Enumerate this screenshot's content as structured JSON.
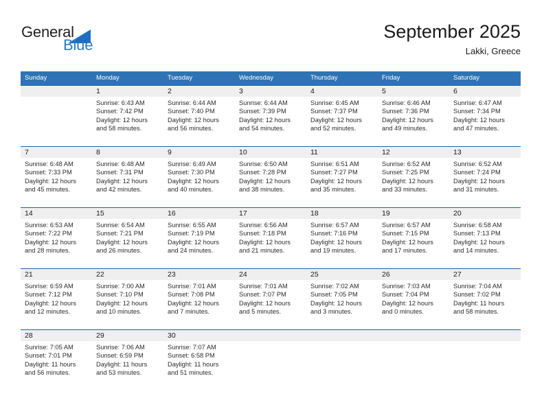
{
  "logo": {
    "general_text": "General",
    "blue_text": "Blue",
    "triangle_icon": "triangle-icon",
    "accent_color": "#2b7cc4"
  },
  "header": {
    "title": "September 2025",
    "subtitle": "Lakki, Greece"
  },
  "theme": {
    "header_blue": "#2e74b5",
    "row_rule_blue": "#1f5fa8",
    "day_band_gray": "#efefef"
  },
  "weekdays": [
    "Sunday",
    "Monday",
    "Tuesday",
    "Wednesday",
    "Thursday",
    "Friday",
    "Saturday"
  ],
  "weeks": [
    [
      {
        "day": "",
        "sunrise": "",
        "sunset": "",
        "daylight1": "",
        "daylight2": ""
      },
      {
        "day": "1",
        "sunrise": "Sunrise: 6:43 AM",
        "sunset": "Sunset: 7:42 PM",
        "daylight1": "Daylight: 12 hours",
        "daylight2": "and 58 minutes."
      },
      {
        "day": "2",
        "sunrise": "Sunrise: 6:44 AM",
        "sunset": "Sunset: 7:40 PM",
        "daylight1": "Daylight: 12 hours",
        "daylight2": "and 56 minutes."
      },
      {
        "day": "3",
        "sunrise": "Sunrise: 6:44 AM",
        "sunset": "Sunset: 7:39 PM",
        "daylight1": "Daylight: 12 hours",
        "daylight2": "and 54 minutes."
      },
      {
        "day": "4",
        "sunrise": "Sunrise: 6:45 AM",
        "sunset": "Sunset: 7:37 PM",
        "daylight1": "Daylight: 12 hours",
        "daylight2": "and 52 minutes."
      },
      {
        "day": "5",
        "sunrise": "Sunrise: 6:46 AM",
        "sunset": "Sunset: 7:36 PM",
        "daylight1": "Daylight: 12 hours",
        "daylight2": "and 49 minutes."
      },
      {
        "day": "6",
        "sunrise": "Sunrise: 6:47 AM",
        "sunset": "Sunset: 7:34 PM",
        "daylight1": "Daylight: 12 hours",
        "daylight2": "and 47 minutes."
      }
    ],
    [
      {
        "day": "7",
        "sunrise": "Sunrise: 6:48 AM",
        "sunset": "Sunset: 7:33 PM",
        "daylight1": "Daylight: 12 hours",
        "daylight2": "and 45 minutes."
      },
      {
        "day": "8",
        "sunrise": "Sunrise: 6:48 AM",
        "sunset": "Sunset: 7:31 PM",
        "daylight1": "Daylight: 12 hours",
        "daylight2": "and 42 minutes."
      },
      {
        "day": "9",
        "sunrise": "Sunrise: 6:49 AM",
        "sunset": "Sunset: 7:30 PM",
        "daylight1": "Daylight: 12 hours",
        "daylight2": "and 40 minutes."
      },
      {
        "day": "10",
        "sunrise": "Sunrise: 6:50 AM",
        "sunset": "Sunset: 7:28 PM",
        "daylight1": "Daylight: 12 hours",
        "daylight2": "and 38 minutes."
      },
      {
        "day": "11",
        "sunrise": "Sunrise: 6:51 AM",
        "sunset": "Sunset: 7:27 PM",
        "daylight1": "Daylight: 12 hours",
        "daylight2": "and 35 minutes."
      },
      {
        "day": "12",
        "sunrise": "Sunrise: 6:52 AM",
        "sunset": "Sunset: 7:25 PM",
        "daylight1": "Daylight: 12 hours",
        "daylight2": "and 33 minutes."
      },
      {
        "day": "13",
        "sunrise": "Sunrise: 6:52 AM",
        "sunset": "Sunset: 7:24 PM",
        "daylight1": "Daylight: 12 hours",
        "daylight2": "and 31 minutes."
      }
    ],
    [
      {
        "day": "14",
        "sunrise": "Sunrise: 6:53 AM",
        "sunset": "Sunset: 7:22 PM",
        "daylight1": "Daylight: 12 hours",
        "daylight2": "and 28 minutes."
      },
      {
        "day": "15",
        "sunrise": "Sunrise: 6:54 AM",
        "sunset": "Sunset: 7:21 PM",
        "daylight1": "Daylight: 12 hours",
        "daylight2": "and 26 minutes."
      },
      {
        "day": "16",
        "sunrise": "Sunrise: 6:55 AM",
        "sunset": "Sunset: 7:19 PM",
        "daylight1": "Daylight: 12 hours",
        "daylight2": "and 24 minutes."
      },
      {
        "day": "17",
        "sunrise": "Sunrise: 6:56 AM",
        "sunset": "Sunset: 7:18 PM",
        "daylight1": "Daylight: 12 hours",
        "daylight2": "and 21 minutes."
      },
      {
        "day": "18",
        "sunrise": "Sunrise: 6:57 AM",
        "sunset": "Sunset: 7:16 PM",
        "daylight1": "Daylight: 12 hours",
        "daylight2": "and 19 minutes."
      },
      {
        "day": "19",
        "sunrise": "Sunrise: 6:57 AM",
        "sunset": "Sunset: 7:15 PM",
        "daylight1": "Daylight: 12 hours",
        "daylight2": "and 17 minutes."
      },
      {
        "day": "20",
        "sunrise": "Sunrise: 6:58 AM",
        "sunset": "Sunset: 7:13 PM",
        "daylight1": "Daylight: 12 hours",
        "daylight2": "and 14 minutes."
      }
    ],
    [
      {
        "day": "21",
        "sunrise": "Sunrise: 6:59 AM",
        "sunset": "Sunset: 7:12 PM",
        "daylight1": "Daylight: 12 hours",
        "daylight2": "and 12 minutes."
      },
      {
        "day": "22",
        "sunrise": "Sunrise: 7:00 AM",
        "sunset": "Sunset: 7:10 PM",
        "daylight1": "Daylight: 12 hours",
        "daylight2": "and 10 minutes."
      },
      {
        "day": "23",
        "sunrise": "Sunrise: 7:01 AM",
        "sunset": "Sunset: 7:08 PM",
        "daylight1": "Daylight: 12 hours",
        "daylight2": "and 7 minutes."
      },
      {
        "day": "24",
        "sunrise": "Sunrise: 7:01 AM",
        "sunset": "Sunset: 7:07 PM",
        "daylight1": "Daylight: 12 hours",
        "daylight2": "and 5 minutes."
      },
      {
        "day": "25",
        "sunrise": "Sunrise: 7:02 AM",
        "sunset": "Sunset: 7:05 PM",
        "daylight1": "Daylight: 12 hours",
        "daylight2": "and 3 minutes."
      },
      {
        "day": "26",
        "sunrise": "Sunrise: 7:03 AM",
        "sunset": "Sunset: 7:04 PM",
        "daylight1": "Daylight: 12 hours",
        "daylight2": "and 0 minutes."
      },
      {
        "day": "27",
        "sunrise": "Sunrise: 7:04 AM",
        "sunset": "Sunset: 7:02 PM",
        "daylight1": "Daylight: 11 hours",
        "daylight2": "and 58 minutes."
      }
    ],
    [
      {
        "day": "28",
        "sunrise": "Sunrise: 7:05 AM",
        "sunset": "Sunset: 7:01 PM",
        "daylight1": "Daylight: 11 hours",
        "daylight2": "and 56 minutes."
      },
      {
        "day": "29",
        "sunrise": "Sunrise: 7:06 AM",
        "sunset": "Sunset: 6:59 PM",
        "daylight1": "Daylight: 11 hours",
        "daylight2": "and 53 minutes."
      },
      {
        "day": "30",
        "sunrise": "Sunrise: 7:07 AM",
        "sunset": "Sunset: 6:58 PM",
        "daylight1": "Daylight: 11 hours",
        "daylight2": "and 51 minutes."
      },
      {
        "day": "",
        "sunrise": "",
        "sunset": "",
        "daylight1": "",
        "daylight2": ""
      },
      {
        "day": "",
        "sunrise": "",
        "sunset": "",
        "daylight1": "",
        "daylight2": ""
      },
      {
        "day": "",
        "sunrise": "",
        "sunset": "",
        "daylight1": "",
        "daylight2": ""
      },
      {
        "day": "",
        "sunrise": "",
        "sunset": "",
        "daylight1": "",
        "daylight2": ""
      }
    ]
  ]
}
